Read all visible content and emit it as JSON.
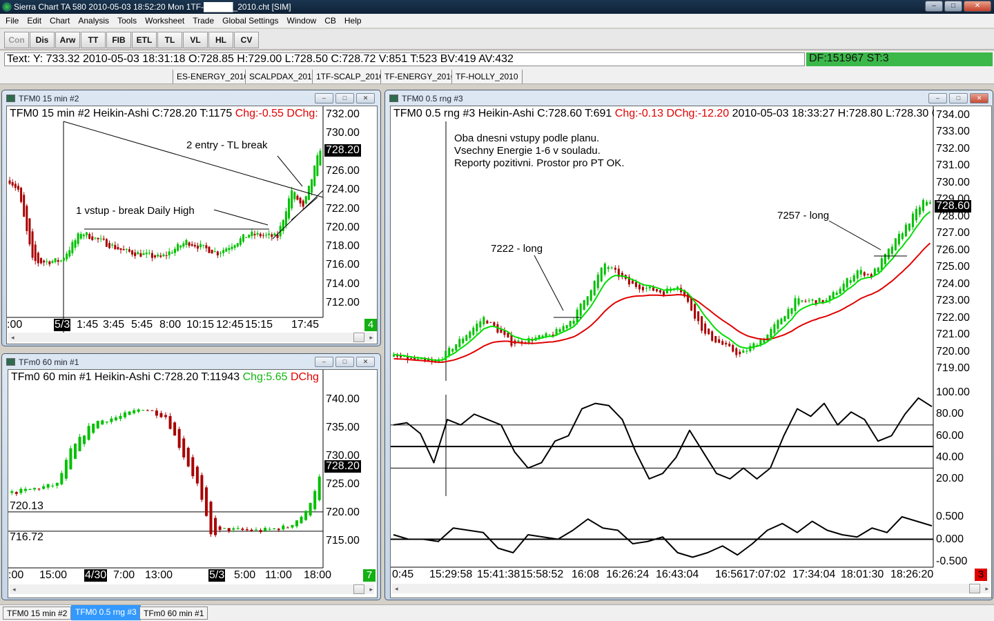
{
  "app": {
    "title": "Sierra Chart TA 580  2010-05-03  18:52:20  Mon   1TF-█████_2010.cht [SIM]",
    "window_buttons": [
      "–",
      "□",
      "✕"
    ]
  },
  "menu": [
    "File",
    "Edit",
    "Chart",
    "Analysis",
    "Tools",
    "Worksheet",
    "Trade",
    "Global Settings",
    "Window",
    "CB",
    "Help"
  ],
  "toolbar": [
    "Con",
    "Dis",
    "Arw",
    "TT",
    "FIB",
    "ETL",
    "TL",
    "VL",
    "HL",
    "CV"
  ],
  "status": {
    "text": "Text: Y: 733.32  2010-05-03  18:31:18  O:728.85  H:729.00  L:728.50  C:728.72  V:851  T:523  BV:419  AV:432",
    "df": "DF:151967  ST:3",
    "df_color": "#3cb84a"
  },
  "chartbook_tabs": [
    "ES-ENERGY_2010",
    "SCALPDAX_2010",
    "1TF-SCALP_2010",
    "TF-ENERGY_2010",
    "TF-HOLLY_2010"
  ],
  "win_controls": [
    "–",
    "□",
    "✕"
  ],
  "chart15": {
    "window_title": "TFM0  15 min   #2",
    "hdr_main": "TFM0  15 min   #2 Heikin-Ashi C:728.20 T:1175 ",
    "hdr_chg": "Chg:-0.55 DChg:",
    "yticks": [
      "732.00",
      "730.00",
      "726.00",
      "724.00",
      "722.00",
      "720.00",
      "718.00",
      "716.00",
      "714.00",
      "712.00"
    ],
    "ytick_values": [
      732,
      730,
      726,
      724,
      722,
      720,
      718,
      716,
      714,
      712
    ],
    "last_price": "728.20",
    "last_value": 728.2,
    "times": [
      ":00",
      "5/3",
      "1:45",
      "3:45",
      "5:45",
      "8:00",
      "10:15",
      "12:45",
      "15:15",
      "17:45"
    ],
    "bar_counter": "4",
    "annotations": [
      "2 entry - TL break",
      "1 vstup - break Daily High"
    ],
    "price_path": [
      [
        0,
        725
      ],
      [
        3,
        724
      ],
      [
        8,
        716.5
      ],
      [
        10,
        716.3
      ],
      [
        18,
        716.5
      ],
      [
        25,
        719.5
      ],
      [
        40,
        717.5
      ],
      [
        53,
        716.8
      ],
      [
        62,
        718.5
      ],
      [
        73,
        717.3
      ],
      [
        84,
        719.3
      ],
      [
        94,
        719
      ],
      [
        99,
        724
      ],
      [
        103,
        722
      ],
      [
        110,
        729.5
      ]
    ],
    "bars": 110
  },
  "chart60": {
    "window_title": "TFm0  60 min   #1",
    "hdr_main": "TFm0  60 min   #1 Heikin-Ashi C:728.20 T:11943 ",
    "hdr_chg": "Chg:5.65 ",
    "hdr_dchg": "DChg",
    "yticks": [
      "740.00",
      "735.00",
      "730.00",
      "725.00",
      "720.00",
      "715.00"
    ],
    "ytick_values": [
      740,
      735,
      730,
      725,
      720,
      715
    ],
    "last_price": "728.20",
    "last_value": 728.2,
    "levels": [
      "720.13",
      "716.72"
    ],
    "level_values": [
      720.13,
      716.72
    ],
    "times": [
      ":00",
      "15:00",
      "4/30",
      "7:00",
      "13:00",
      "5/3",
      "5:00",
      "11:00",
      "18:00"
    ],
    "bar_counter": "7",
    "price_path": [
      [
        0,
        723.5
      ],
      [
        10,
        725
      ],
      [
        13,
        731
      ],
      [
        18,
        736
      ],
      [
        24,
        737
      ],
      [
        29,
        738.5
      ],
      [
        34,
        737
      ],
      [
        38,
        730
      ],
      [
        41,
        725
      ],
      [
        44,
        716
      ],
      [
        47,
        717
      ],
      [
        55,
        716.8
      ],
      [
        61,
        717.5
      ],
      [
        65,
        720
      ],
      [
        69,
        728.2
      ]
    ],
    "bars": 69
  },
  "chartR": {
    "window_title": "TFM0  0.5 rng  #3",
    "hdr_main": "TFM0  0.5 rng  #3 Heikin-Ashi C:728.60 T:691 ",
    "hdr_chg": "Chg:-0.13 DChg:-12.20",
    "hdr_rest": " 2010-05-03 18:33:27 H:728.80 L:728.30 C",
    "yticks": [
      "734.00",
      "733.00",
      "732.00",
      "731.00",
      "730.00",
      "729.00",
      "728.00",
      "727.00",
      "726.00",
      "725.00",
      "724.00",
      "723.00",
      "722.00",
      "721.00",
      "720.00",
      "719.00"
    ],
    "ytick_values": [
      734,
      733,
      732,
      731,
      730,
      729,
      728,
      727,
      726,
      725,
      724,
      723,
      722,
      721,
      720,
      719
    ],
    "last_price": "728.60",
    "last_value": 728.6,
    "osc1_ticks": [
      "100.00",
      "80.00",
      "60.00",
      "40.00",
      "20.00"
    ],
    "osc1_tick_values": [
      100,
      80,
      60,
      40,
      20
    ],
    "osc1_levels": [
      70,
      50,
      30
    ],
    "osc2_ticks": [
      "0.500",
      "0.000",
      "-0.500"
    ],
    "osc2_tick_values": [
      0.5,
      0,
      -0.5
    ],
    "times": [
      "0:45",
      "15:29:58",
      "15:41:38",
      "15:58:52",
      "16:08",
      "16:26:24",
      "16:43:04",
      "16:56",
      "17:07:02",
      "17:34:04",
      "18:01:30",
      "18:26:20"
    ],
    "bar_counter": "3",
    "note_lines": [
      "Oba dnesni vstupy podle planu.",
      "Vsechny Energie 1-6 v souladu.",
      "Reporty pozitivni. Prostor pro PT OK."
    ],
    "annotations": [
      "7222 - long",
      "7257 - long"
    ],
    "price_path": [
      [
        0,
        719.7
      ],
      [
        12,
        719.3
      ],
      [
        26,
        722
      ],
      [
        34,
        720.5
      ],
      [
        46,
        721
      ],
      [
        52,
        722
      ],
      [
        61,
        725.2
      ],
      [
        68,
        724
      ],
      [
        78,
        723.5
      ],
      [
        82,
        724
      ],
      [
        90,
        721
      ],
      [
        100,
        719.8
      ],
      [
        108,
        721
      ],
      [
        116,
        723
      ],
      [
        125,
        723
      ],
      [
        134,
        724.8
      ],
      [
        138,
        724.5
      ],
      [
        153,
        728.9
      ],
      [
        156,
        728.6
      ]
    ],
    "bars": 156,
    "osc1": [
      70,
      72,
      62,
      35,
      75,
      70,
      80,
      75,
      70,
      45,
      30,
      35,
      55,
      60,
      85,
      90,
      88,
      75,
      45,
      20,
      25,
      40,
      65,
      45,
      25,
      20,
      30,
      20,
      30,
      60,
      85,
      78,
      90,
      70,
      82,
      75,
      55,
      60,
      80,
      95,
      87
    ],
    "osc2": [
      0.1,
      0,
      0,
      -0.05,
      0.25,
      0.2,
      0.15,
      -0.2,
      -0.3,
      0.1,
      0.05,
      0,
      0.2,
      0.45,
      0.25,
      0.2,
      -0.1,
      -0.05,
      0.05,
      -0.3,
      -0.4,
      -0.3,
      -0.15,
      -0.35,
      -0.1,
      0.2,
      0.35,
      0.15,
      0.4,
      0.2,
      0.1,
      0.05,
      0.25,
      0.15,
      0.5,
      0.4,
      0.3
    ]
  },
  "bottom_tabs": [
    "TFM0  15 min   #2",
    "TFM0  0.5 rng  #3",
    "TFm0  60 min   #1"
  ],
  "colors": {
    "up": "#00c000",
    "down": "#a80000",
    "ma_fast": "#00dd00",
    "ma_slow": "#e00000"
  }
}
